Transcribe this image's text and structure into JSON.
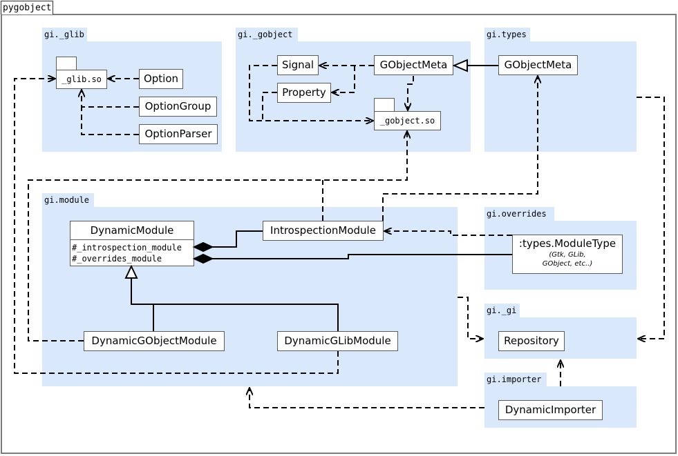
{
  "frame": {
    "title": "pygobject"
  },
  "packages": {
    "glib": {
      "label": "gi._glib",
      "lib": "_glib.so",
      "classes": [
        "Option",
        "OptionGroup",
        "OptionParser"
      ]
    },
    "gobject": {
      "label": "gi._gobject",
      "lib": "_gobject.so",
      "classes": [
        "Signal",
        "Property",
        "GObjectMeta"
      ]
    },
    "types": {
      "label": "gi.types",
      "classes": [
        "GObjectMeta"
      ]
    },
    "module": {
      "label": "gi.module",
      "dynamic_module": {
        "name": "DynamicModule",
        "attributes": [
          "#_introspection_module",
          "#_overrides_module"
        ]
      },
      "classes": [
        "IntrospectionModule",
        "DynamicGObjectModule",
        "DynamicGLibModule"
      ]
    },
    "overrides": {
      "label": "gi.overrides",
      "object": {
        "name": ":types.ModuleType",
        "note_line1": "(Gtk, GLib,",
        "note_line2": "GObject, etc..)"
      }
    },
    "gi": {
      "label": "gi._gi",
      "classes": [
        "Repository"
      ]
    },
    "importer": {
      "label": "gi.importer",
      "classes": [
        "DynamicImporter"
      ]
    }
  },
  "colors": {
    "package_fill": "#d9e9fb",
    "frame_border": "#7a7a7a",
    "class_border": "#5a5a5a",
    "edge": "#000000"
  }
}
